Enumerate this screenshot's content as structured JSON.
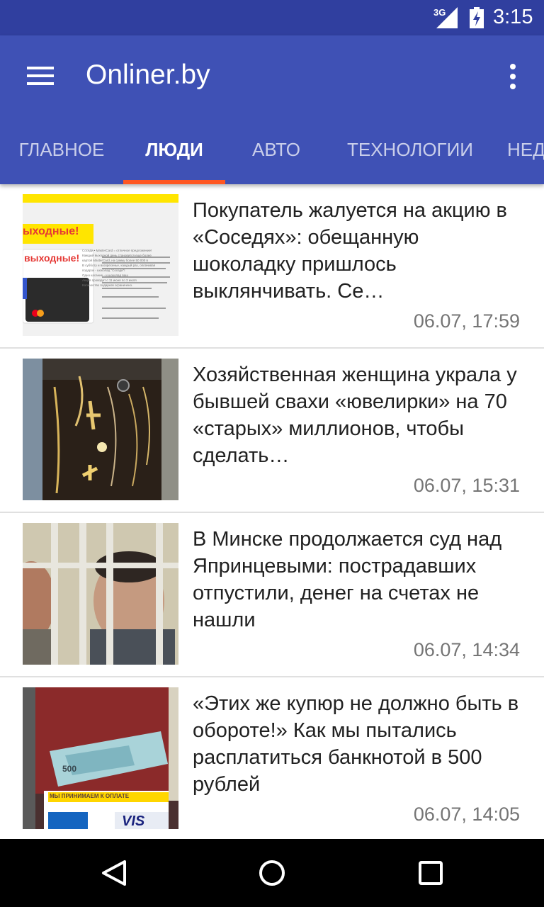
{
  "status_bar": {
    "network": "3G",
    "time": "3:15"
  },
  "app_bar": {
    "title": "Onliner.by",
    "menu_icon": "hamburger-menu-icon",
    "overflow_icon": "more-vertical-icon",
    "background_color": "#3f51b5"
  },
  "tabs": [
    {
      "label": "ГЛАВНОЕ",
      "active": false
    },
    {
      "label": "ЛЮДИ",
      "active": true
    },
    {
      "label": "АВТО",
      "active": false
    },
    {
      "label": "ТЕХНОЛОГИИ",
      "active": false
    },
    {
      "label": "НЕД",
      "active": false
    }
  ],
  "tab_indicator_color": "#ff5722",
  "news": [
    {
      "headline": "Покупатель жалуется на акцию в «Соседях»: обещанную шоколадку пришлось выклянчивать. Се…",
      "date": "06.07, 17:59"
    },
    {
      "headline": "Хозяйственная женщина украла у бывшей свахи «ювелирки» на 70 «старых» миллионов, чтобы сделать…",
      "date": "06.07, 15:31"
    },
    {
      "headline": "В Минске продолжается суд над Япринцевыми: пострадавших отпустили, денег на счетах не нашли",
      "date": "06.07, 14:34"
    },
    {
      "headline": "«Этих же купюр не должно быть в обороте!» Как мы пытались расплатиться банкнотой в 500 рублей",
      "date": "06.07, 14:05"
    }
  ],
  "thumbnails": {
    "promo_heading": "ыходные!",
    "card_heading": "выходные!",
    "promo_lines": [
      "Соседи • MasterCard = отличное предложение!",
      "Каждый выходной день становится еще более",
      "картой MasterCard, на сумму более 50 000 в",
      "В субботу и воскресенье, каждый раз, оплачивая",
      "подарок - шоколад \"Соседи\"!",
      "Одно касание - и шоколад ваш",
      "Акция проводит с 11 июня по 3 июля",
      "Количество подарков ограничено."
    ],
    "banknote_value": "500",
    "sign_text": "МЫ ПРИНИМАЕМ К ОПЛАТЕ",
    "visa_text": "VIS"
  },
  "nav_bar": {
    "back_icon": "back-icon",
    "home_icon": "home-icon",
    "recents_icon": "recents-icon"
  }
}
